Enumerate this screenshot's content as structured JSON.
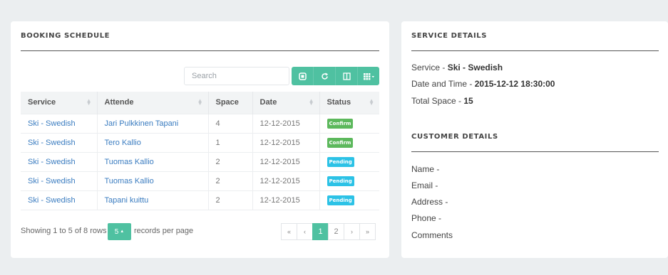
{
  "booking": {
    "title": "BOOKING SCHEDULE",
    "search_placeholder": "Search",
    "toolbar_icons": [
      "square-icon",
      "refresh-icon",
      "columns-icon",
      "grid-icon"
    ],
    "columns": [
      "Service",
      "Attende",
      "Space",
      "Date",
      "Status"
    ],
    "rows": [
      {
        "service": "Ski - Swedish",
        "attende": "Jari Pulkkinen Tapani",
        "space": "4",
        "date": "12-12-2015",
        "status": "Confirm",
        "status_color": "#5cb85c"
      },
      {
        "service": "Ski - Swedish",
        "attende": "Tero Kallio",
        "space": "1",
        "date": "12-12-2015",
        "status": "Confirm",
        "status_color": "#5cb85c"
      },
      {
        "service": "Ski - Swedish",
        "attende": "Tuomas Kallio",
        "space": "2",
        "date": "12-12-2015",
        "status": "Pending",
        "status_color": "#2cc2e6"
      },
      {
        "service": "Ski - Swedish",
        "attende": "Tuomas Kallio",
        "space": "2",
        "date": "12-12-2015",
        "status": "Pending",
        "status_color": "#2cc2e6"
      },
      {
        "service": "Ski - Swedish",
        "attende": "Tapani kuittu",
        "space": "2",
        "date": "12-12-2015",
        "status": "Pending",
        "status_color": "#2cc2e6"
      }
    ],
    "footer": {
      "showing": "Showing 1 to 5 of 8 rows",
      "page_size": "5",
      "records_per_page": "records per page"
    },
    "pagination": {
      "first": "«",
      "prev": "‹",
      "pages": [
        "1",
        "2"
      ],
      "active_page": "1",
      "next": "›",
      "last": "»"
    },
    "accent_color": "#4fc1a1"
  },
  "service_details": {
    "title": "SERVICE DETAILS",
    "service_label": "Service - ",
    "service_value": "Ski - Swedish",
    "datetime_label": "Date and Time - ",
    "datetime_value": "2015-12-12 18:30:00",
    "space_label": "Total Space - ",
    "space_value": "15"
  },
  "customer_details": {
    "title": "CUSTOMER DETAILS",
    "name_label": "Name -",
    "email_label": "Email -",
    "address_label": "Address -",
    "phone_label": "Phone -",
    "comments_label": "Comments"
  }
}
